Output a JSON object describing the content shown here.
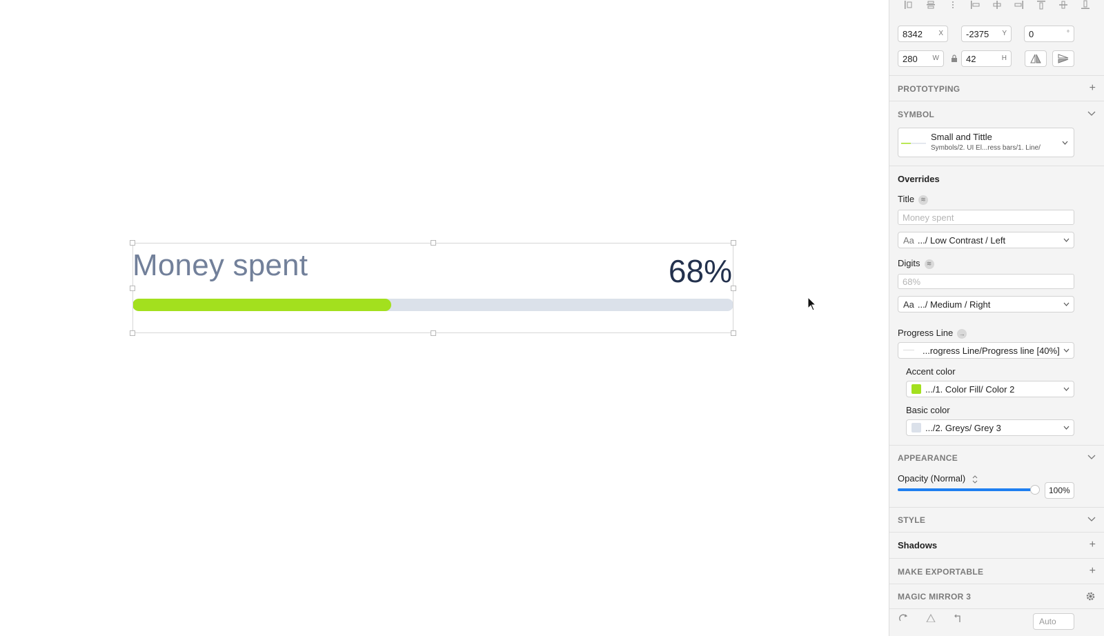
{
  "canvas": {
    "title": "Money spent",
    "digits": "68%",
    "progress": 0.43,
    "accent_color": "#a3e01e",
    "basic_color": "#dbe1ea"
  },
  "inspector": {
    "position": {
      "x": "8342",
      "x_label": "X",
      "y": "-2375",
      "y_label": "Y",
      "rotation": "0",
      "rotation_label": "°"
    },
    "size": {
      "w": "280",
      "w_label": "W",
      "h": "42",
      "h_label": "H"
    },
    "prototyping": {
      "header": "PROTOTYPING"
    },
    "symbol": {
      "header": "SYMBOL",
      "name": "Small and Tittle",
      "path": "Symbols/2. UI El...ress bars/1. Line/"
    },
    "overrides": {
      "header": "Overrides",
      "title_label": "Title",
      "title_placeholder": "Money spent",
      "title_style": ".../ Low Contrast / Left",
      "digits_label": "Digits",
      "digits_placeholder": "68%",
      "digits_style": ".../ Medium / Right",
      "progress_line_label": "Progress Line",
      "progress_line_value": "...rogress Line/Progress line [40%]",
      "accent_color_label": "Accent color",
      "accent_color_value": ".../1. Color Fill/ Color 2",
      "accent_color_hex": "#a3e01e",
      "basic_color_label": "Basic color",
      "basic_color_value": ".../2. Greys/ Grey 3",
      "basic_color_hex": "#dbe1ea",
      "aa_glyph": "Aa"
    },
    "appearance": {
      "header": "APPEARANCE",
      "opacity_label": "Opacity (Normal)",
      "opacity_value": "100%",
      "opacity_fraction": 1.0
    },
    "style": {
      "header": "STYLE"
    },
    "shadows": {
      "header": "Shadows"
    },
    "make_exportable": {
      "header": "MAKE EXPORTABLE"
    },
    "magic_mirror": {
      "header": "MAGIC MIRROR 3"
    },
    "bottom": {
      "auto_label": "Auto"
    }
  },
  "colors": {
    "accent": "#a3e01e",
    "slider_blue": "#1e7ef0"
  }
}
